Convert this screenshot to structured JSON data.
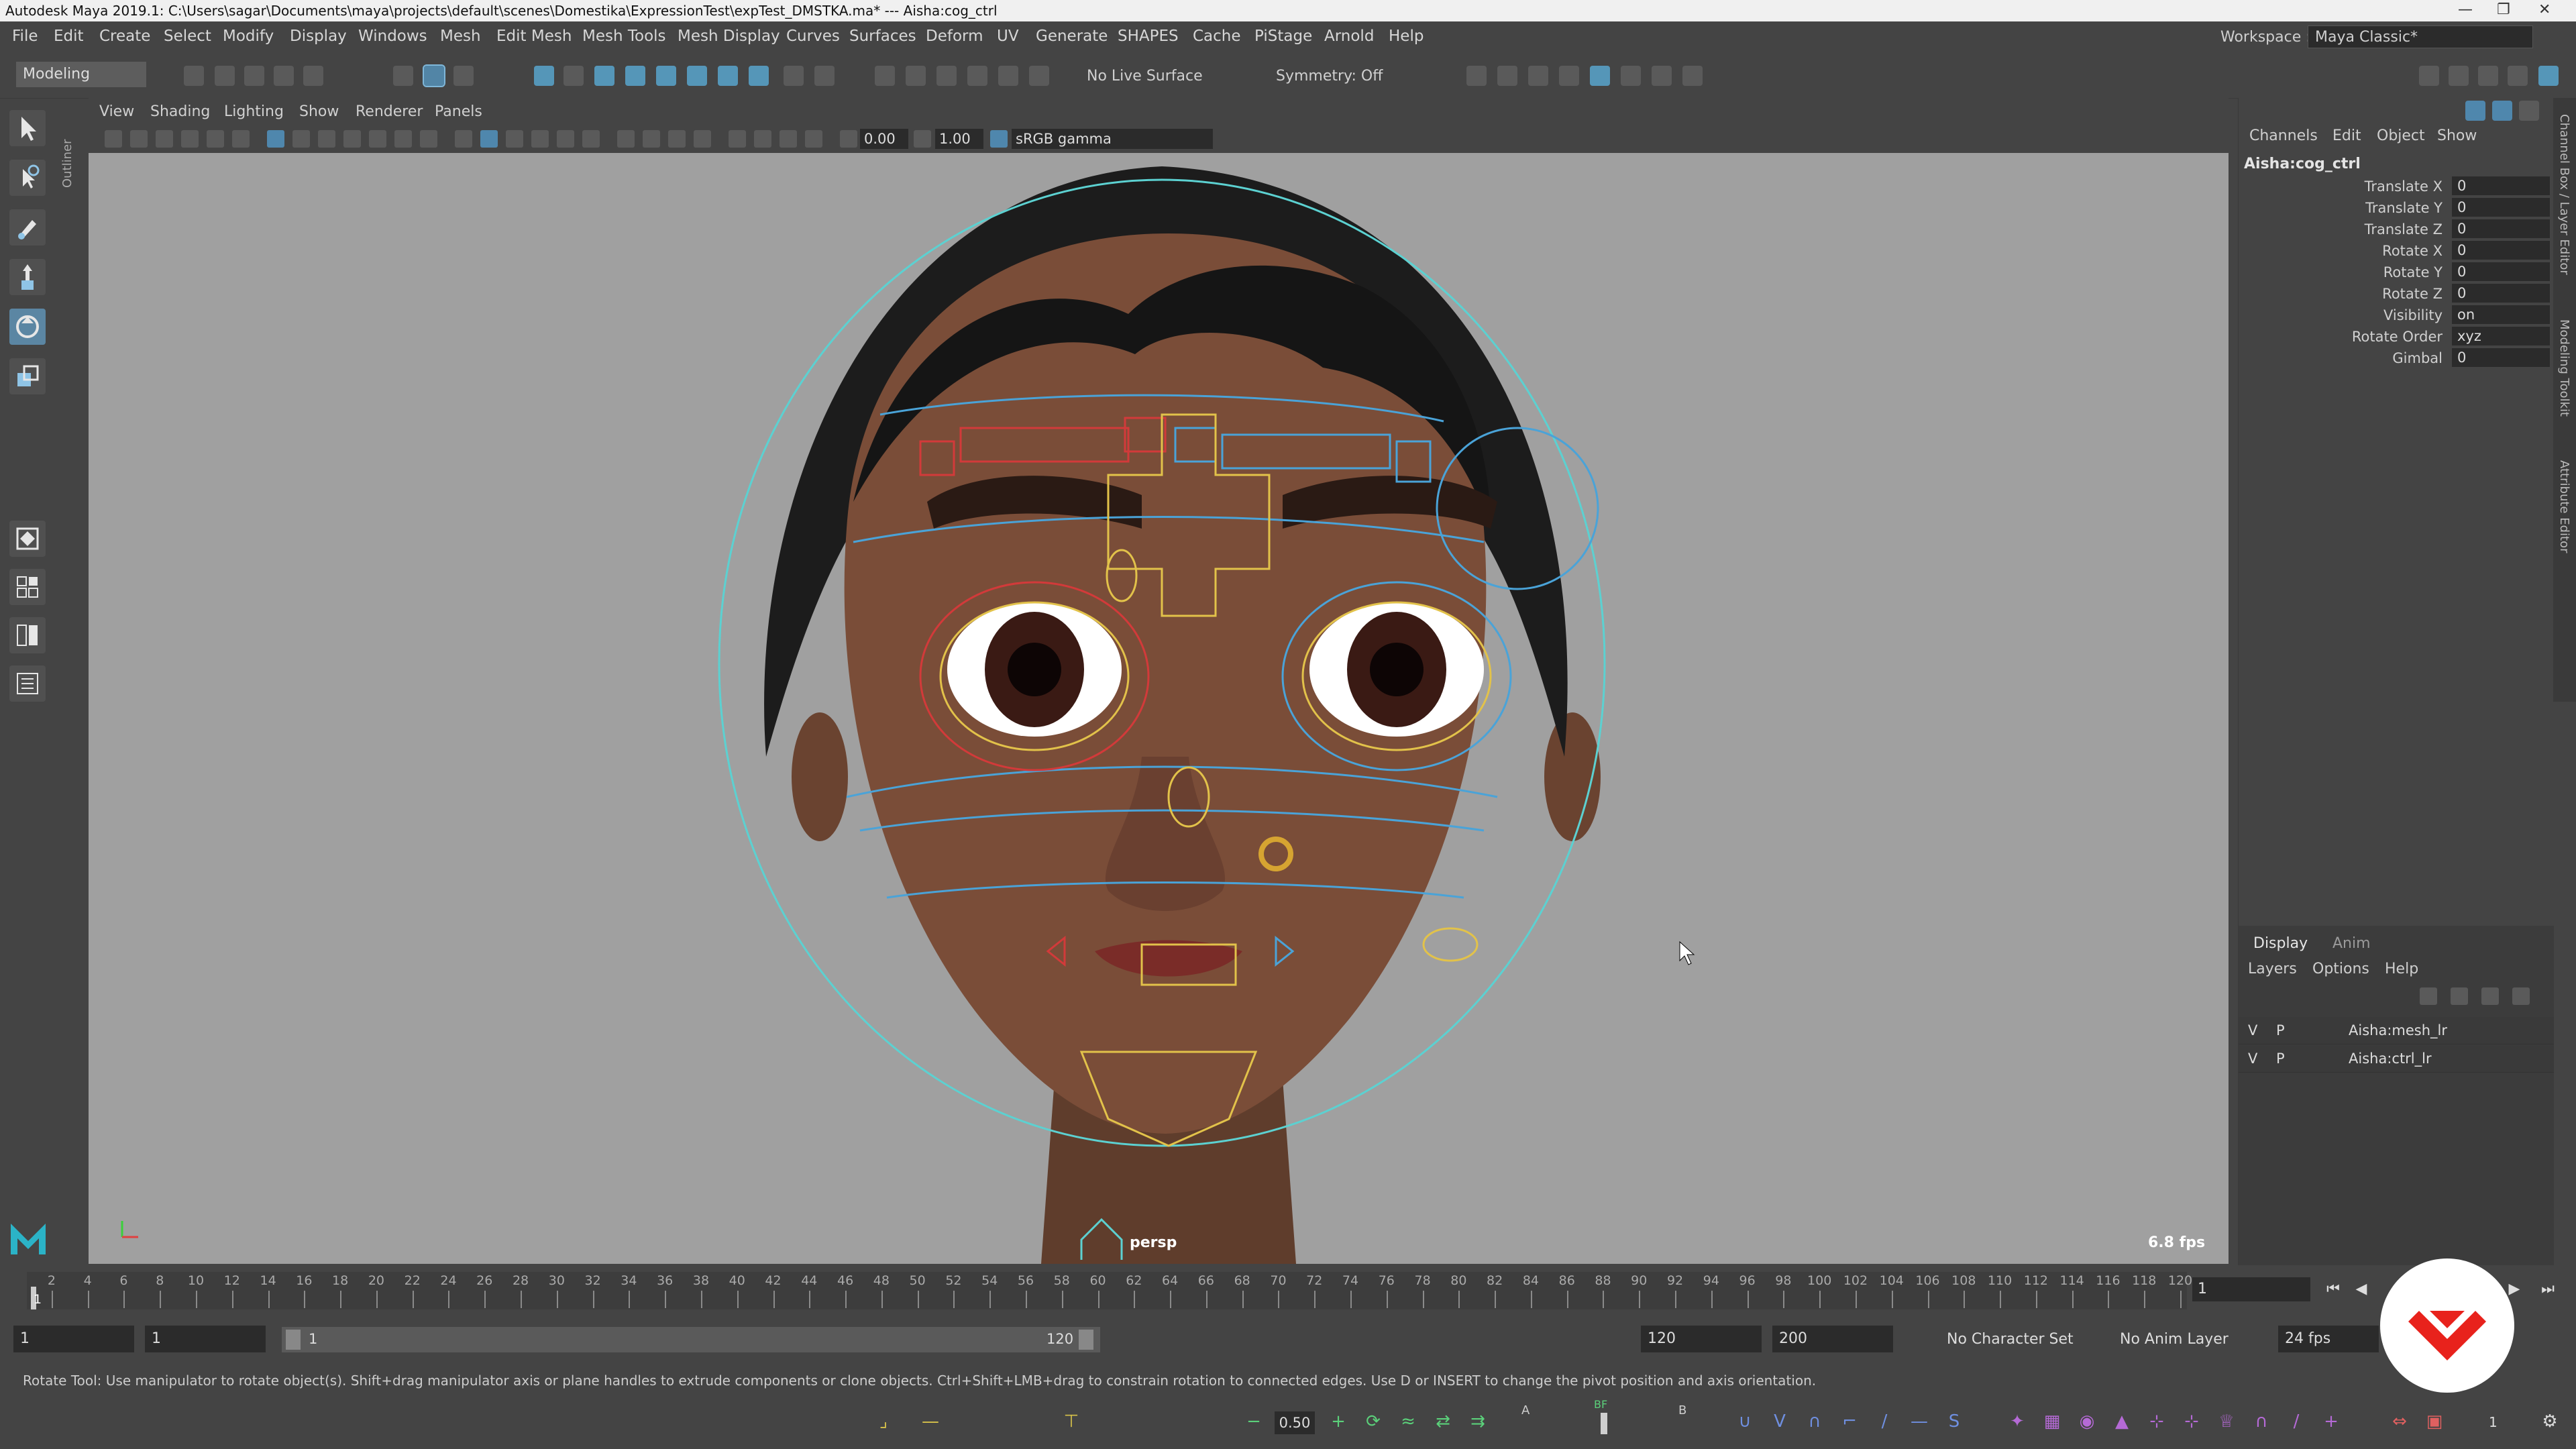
{
  "titlebar": {
    "text": "Autodesk Maya 2019.1: C:\\Users\\sagar\\Documents\\maya\\projects\\default\\scenes\\Domestika\\ExpressionTest\\expTest_DMSTKA.ma*  ---  Aisha:cog_ctrl"
  },
  "menubar": {
    "items": [
      "File",
      "Edit",
      "Create",
      "Select",
      "Modify",
      "Display",
      "Windows",
      "Mesh",
      "Edit Mesh",
      "Mesh Tools",
      "Mesh Display",
      "Curves",
      "Surfaces",
      "Deform",
      "UV",
      "Generate",
      "SHAPES",
      "Cache",
      "PiStage",
      "Arnold",
      "Help"
    ],
    "workspace_label": "Workspace :",
    "workspace_value": "Maya Classic*"
  },
  "statusline": {
    "mode": "Modeling",
    "live_surface": "No Live Surface",
    "symmetry": "Symmetry: Off"
  },
  "outliner_label": "Outliner",
  "panel": {
    "menus": [
      "View",
      "Shading",
      "Lighting",
      "Show",
      "Renderer",
      "Panels"
    ],
    "exposure": "0.00",
    "gamma": "1.00",
    "colorspace": "sRGB gamma",
    "camera": "persp",
    "fps": "6.8 fps"
  },
  "channelbox": {
    "tabs": [
      "Channels",
      "Edit",
      "Object",
      "Show"
    ],
    "node": "Aisha:cog_ctrl",
    "attributes": [
      {
        "name": "Translate X",
        "value": "0"
      },
      {
        "name": "Translate Y",
        "value": "0"
      },
      {
        "name": "Translate Z",
        "value": "0"
      },
      {
        "name": "Rotate X",
        "value": "0"
      },
      {
        "name": "Rotate Y",
        "value": "0"
      },
      {
        "name": "Rotate Z",
        "value": "0"
      },
      {
        "name": "Visibility",
        "value": "on"
      },
      {
        "name": "Rotate Order",
        "value": "xyz"
      },
      {
        "name": "Gimbal",
        "value": "0"
      }
    ]
  },
  "layers": {
    "tabs": [
      "Display",
      "Anim"
    ],
    "menus": [
      "Layers",
      "Options",
      "Help"
    ],
    "rows": [
      {
        "v": "V",
        "p": "P",
        "name": "Aisha:mesh_lr"
      },
      {
        "v": "V",
        "p": "P",
        "name": "Aisha:ctrl_lr"
      }
    ]
  },
  "right_vtabs": [
    "Channel Box / Layer Editor",
    "Modeling Toolkit",
    "Attribute Editor"
  ],
  "timeslider": {
    "ticks": [
      "2",
      "4",
      "6",
      "8",
      "10",
      "12",
      "14",
      "16",
      "18",
      "20",
      "22",
      "24",
      "26",
      "28",
      "30",
      "32",
      "34",
      "36",
      "38",
      "40",
      "42",
      "44",
      "46",
      "48",
      "50",
      "52",
      "54",
      "56",
      "58",
      "60",
      "62",
      "64",
      "66",
      "68",
      "70",
      "72",
      "74",
      "76",
      "78",
      "80",
      "82",
      "84",
      "86",
      "88",
      "90",
      "92",
      "94",
      "96",
      "98",
      "100",
      "102",
      "104",
      "106",
      "108",
      "110",
      "112",
      "114",
      "116",
      "118",
      "120"
    ],
    "current_marker_label": "1",
    "current_frame": "1",
    "min": 1,
    "max": 120
  },
  "rangeslider": {
    "start": "1",
    "playback_start": "1",
    "range_start_label": "1",
    "range_end_label": "120",
    "playback_end": "120",
    "end": "200",
    "character_set": "No Character Set",
    "anim_layer": "No Anim Layer",
    "fps": "24 fps"
  },
  "helpline": {
    "text": "Rotate Tool: Use manipulator to rotate object(s). Shift+drag manipulator axis or plane handles to extrude components or clone objects. Ctrl+Shift+LMB+drag to constrain rotation to connected edges. Use D or INSERT to change the pivot position and axis orientation."
  },
  "shelf": {
    "slider_value": "0.50",
    "label_a": "A",
    "label_bf": "BF",
    "label_b": "B",
    "count": "1"
  },
  "colors": {
    "accent": "#5596b8",
    "viewport_bg": "#a0a0a0",
    "ctrl_red": "#d23a3a",
    "ctrl_blue": "#4aa3d8",
    "ctrl_yellow": "#e2c24a",
    "ctrl_cyan": "#5cd1d1",
    "brand_red": "#e8221c"
  }
}
